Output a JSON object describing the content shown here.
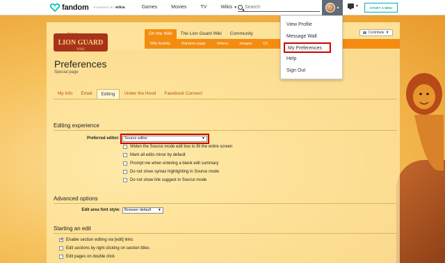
{
  "topbar": {
    "brand": "fandom",
    "powered_by": "POWERED BY",
    "powered_by_brand": "wikia",
    "nav": [
      "Games",
      "Movies",
      "TV",
      "Wikis"
    ],
    "search_placeholder": "Search",
    "start_wiki": "START A WIKI"
  },
  "user_menu": {
    "items": [
      "View Profile",
      "Message Wall",
      "My Preferences",
      "Help",
      "Sign Out"
    ]
  },
  "wiki": {
    "tabs": [
      "On the Wiki",
      "The Lion Guard Wiki",
      "Community"
    ],
    "subtabs": [
      "Wiki Activity",
      "Random page",
      "Videos",
      "Images",
      "Ch"
    ],
    "contribute": "Contribute"
  },
  "page": {
    "title": "Preferences",
    "subtitle": "Special page"
  },
  "pref_tabs": [
    "My Info",
    "Email",
    "Editing",
    "Under the Hood",
    "Facebook Connect"
  ],
  "editing_experience": {
    "title": "Editing experience",
    "editor_label": "Preferred editor:",
    "editor_value": "Source editor",
    "options": [
      {
        "label": "Widen the Source mode edit box to fill the entire screen",
        "checked": false
      },
      {
        "label": "Mark all edits minor by default",
        "checked": false
      },
      {
        "label": "Prompt me when entering a blank edit summary",
        "checked": false
      },
      {
        "label": "Do not show syntax highlighting in Source mode",
        "checked": false
      },
      {
        "label": "Do not show link suggest in Source mode",
        "checked": false
      }
    ]
  },
  "advanced": {
    "title": "Advanced options",
    "font_label": "Edit area font style:",
    "font_value": "Browser default"
  },
  "starting_edit": {
    "title": "Starting an edit",
    "options": [
      {
        "label": "Enable section editing via [edit] links",
        "checked": true
      },
      {
        "label": "Edit sections by right clicking on section titles",
        "checked": false
      },
      {
        "label": "Edit pages on double click",
        "checked": false
      }
    ]
  },
  "colors": {
    "accent": "#f48c10",
    "highlight": "#cc0000",
    "fandom_teal": "#00acac"
  }
}
